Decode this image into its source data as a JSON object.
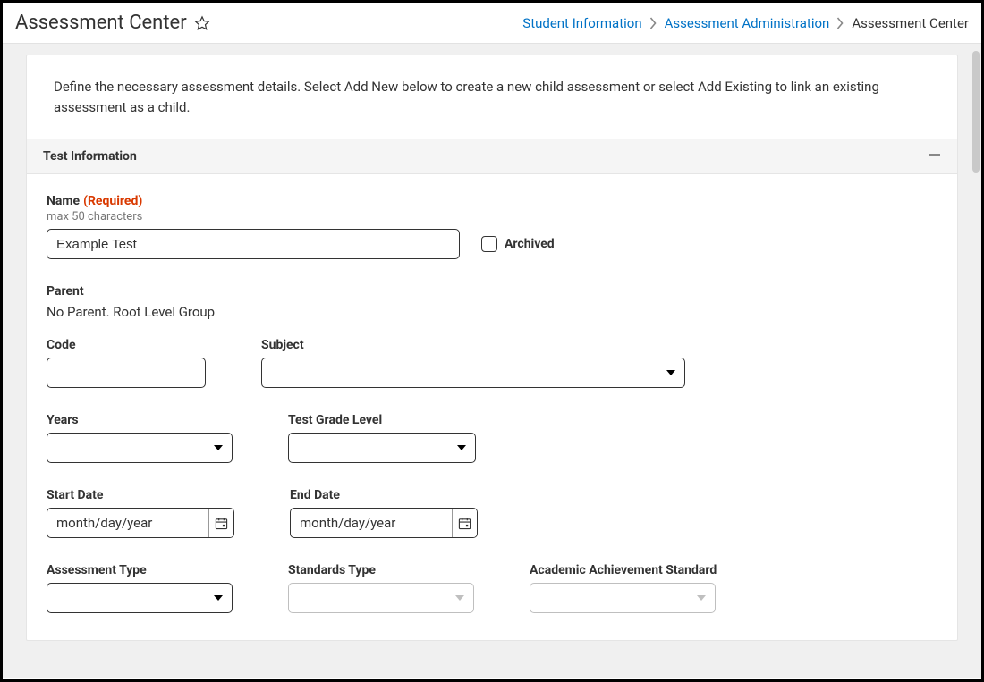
{
  "header": {
    "title": "Assessment Center",
    "breadcrumb": {
      "item1": "Student Information",
      "item2": "Assessment Administration",
      "item3": "Assessment Center"
    }
  },
  "intro": "Define the necessary assessment details. Select Add New below to create a new child assessment or select Add Existing to link an existing assessment as a child.",
  "section": {
    "title": "Test Information"
  },
  "fields": {
    "name": {
      "label": "Name",
      "required": "(Required)",
      "hint": "max 50 characters",
      "value": "Example Test"
    },
    "archived": {
      "label": "Archived"
    },
    "parent": {
      "label": "Parent",
      "value": "No Parent. Root Level Group"
    },
    "code": {
      "label": "Code",
      "value": ""
    },
    "subject": {
      "label": "Subject",
      "value": ""
    },
    "years": {
      "label": "Years",
      "value": ""
    },
    "gradeLevel": {
      "label": "Test Grade Level",
      "value": ""
    },
    "startDate": {
      "label": "Start Date",
      "placeholder": "month/day/year"
    },
    "endDate": {
      "label": "End Date",
      "placeholder": "month/day/year"
    },
    "assessmentType": {
      "label": "Assessment Type",
      "value": ""
    },
    "standardsType": {
      "label": "Standards Type",
      "value": ""
    },
    "achievementStandard": {
      "label": "Academic Achievement Standard",
      "value": ""
    }
  }
}
